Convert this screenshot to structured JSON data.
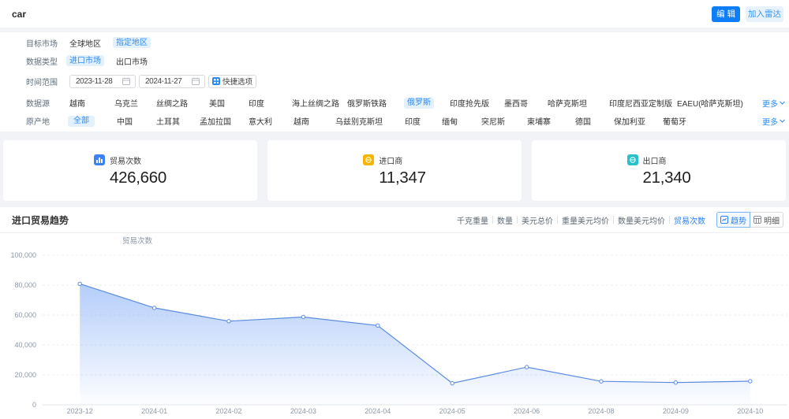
{
  "header": {
    "title": "car",
    "edit_button": "编 辑",
    "radar_button": "加入雷达"
  },
  "filters": {
    "target_market": {
      "label": "目标市场",
      "options": [
        {
          "text": "全球地区",
          "selected": false
        },
        {
          "text": "指定地区",
          "selected": true
        }
      ]
    },
    "data_type": {
      "label": "数据类型",
      "options": [
        {
          "text": "进口市场",
          "selected": true
        },
        {
          "text": "出口市场",
          "selected": false
        }
      ]
    },
    "date_range": {
      "label": "时间范围",
      "start": "2023-11-28",
      "end": "2024-11-27",
      "quick_button": "快捷选项"
    },
    "data_source": {
      "label": "数据源",
      "more": "更多",
      "options": [
        {
          "text": "越南",
          "selected": false
        },
        {
          "text": "乌克兰",
          "selected": false
        },
        {
          "text": "丝绸之路",
          "selected": false
        },
        {
          "text": "美国",
          "selected": false
        },
        {
          "text": "印度",
          "selected": false
        },
        {
          "text": "海上丝绸之路",
          "selected": false
        },
        {
          "text": "俄罗斯铁路",
          "selected": false
        },
        {
          "text": "俄罗斯",
          "selected": true
        },
        {
          "text": "印度抢先版",
          "selected": false
        },
        {
          "text": "墨西哥",
          "selected": false
        },
        {
          "text": "哈萨克斯坦",
          "selected": false
        },
        {
          "text": "印度尼西亚定制版",
          "selected": false
        },
        {
          "text": "EAEU(哈萨克斯坦)",
          "selected": false
        }
      ]
    },
    "origin": {
      "label": "原产地",
      "more": "更多",
      "options": [
        {
          "text": "全部",
          "selected": true
        },
        {
          "text": "中国",
          "selected": false
        },
        {
          "text": "土耳其",
          "selected": false
        },
        {
          "text": "孟加拉国",
          "selected": false
        },
        {
          "text": "意大利",
          "selected": false
        },
        {
          "text": "越南",
          "selected": false
        },
        {
          "text": "乌兹别克斯坦",
          "selected": false
        },
        {
          "text": "印度",
          "selected": false
        },
        {
          "text": "缅甸",
          "selected": false
        },
        {
          "text": "突尼斯",
          "selected": false
        },
        {
          "text": "柬埔寨",
          "selected": false
        },
        {
          "text": "德国",
          "selected": false
        },
        {
          "text": "保加利亚",
          "selected": false
        },
        {
          "text": "葡萄牙",
          "selected": false
        }
      ]
    }
  },
  "stats": [
    {
      "label": "贸易次数",
      "value": "426,660",
      "icon": "bar-chart-icon",
      "color": "#3b82f6"
    },
    {
      "label": "进口商",
      "value": "11,347",
      "icon": "importer-icon",
      "color": "#f7b500"
    },
    {
      "label": "出口商",
      "value": "21,340",
      "icon": "exporter-icon",
      "color": "#27c2c9"
    }
  ],
  "chart": {
    "title": "进口贸易趋势",
    "metric_tabs": [
      "千克重量",
      "数量",
      "美元总价",
      "重量美元均价",
      "数量美元均价",
      "贸易次数"
    ],
    "selected_metric": "贸易次数",
    "view_buttons": [
      {
        "text": "趋势",
        "selected": true
      },
      {
        "text": "明细",
        "selected": false
      }
    ]
  },
  "chart_data": {
    "type": "area",
    "title": "进口贸易趋势",
    "ylabel": "贸易次数",
    "categories": [
      "2023-12",
      "2024-01",
      "2024-02",
      "2024-03",
      "2024-04",
      "2024-05",
      "2024-06",
      "2024-08",
      "2024-09",
      "2024-10"
    ],
    "values": [
      80900,
      64800,
      55900,
      58700,
      53000,
      14400,
      25200,
      15700,
      14900,
      15800
    ],
    "ylim": [
      0,
      100000
    ],
    "ytick_step": 20000,
    "grid": true,
    "legend": "none",
    "line_color": "#5b8ce0"
  }
}
